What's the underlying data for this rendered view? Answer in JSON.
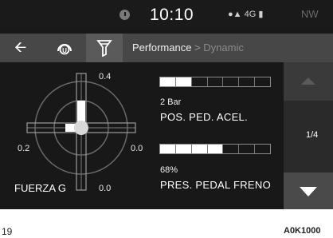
{
  "status": {
    "time": "10:10",
    "network": "4G",
    "user_id": "NW"
  },
  "breadcrumb": {
    "section": "Performance",
    "separator": ">",
    "current": "Dynamic"
  },
  "gforce": {
    "title": "FUERZA G",
    "top_value": "0.4",
    "left_value": "0.2",
    "right_value": "0.0",
    "bottom_value": "0.0",
    "levels": {
      "up": 2,
      "left": 1,
      "right": 0,
      "down": 0,
      "max": 4
    }
  },
  "metrics": [
    {
      "value": "2 Bar",
      "label": "POS. PED. ACEL.",
      "segments_on": 2,
      "segments_total": 7
    },
    {
      "value": "68%",
      "label": "PRES. PEDAL FRENO",
      "segments_on": 4,
      "segments_total": 7
    }
  ],
  "pager": {
    "indicator": "1/4"
  },
  "footer": {
    "page": "19",
    "code": "A0K1000"
  },
  "colors": {
    "background": "#181818",
    "nav": "#474747",
    "bar_fill": "#ffffff"
  }
}
